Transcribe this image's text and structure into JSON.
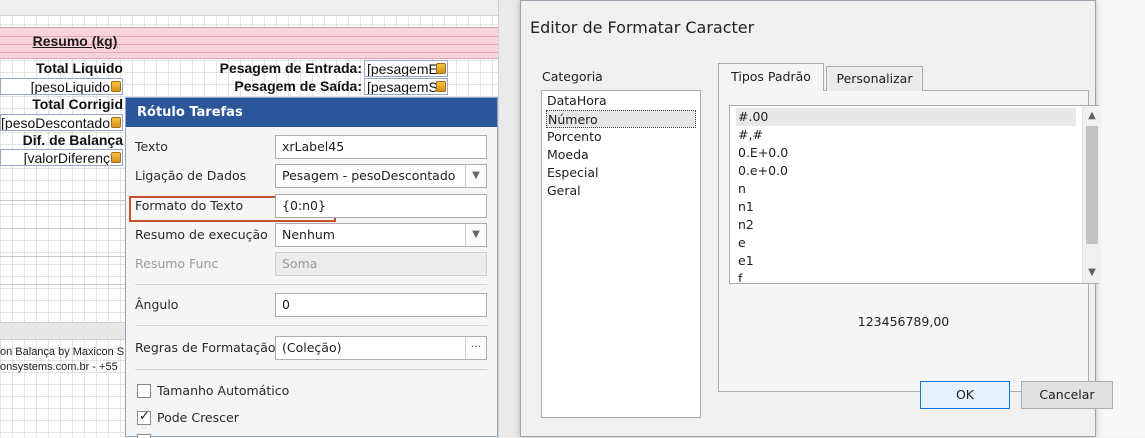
{
  "report": {
    "resumo_title": "Resumo (kg)",
    "labels": {
      "total_liquido": "Total Liquido",
      "peso_liquido": "[pesoLiquido",
      "total_corrigido": "Total Corrigid",
      "peso_descontado": "[pesoDescontado",
      "dif_balanca": "Dif. de Balança",
      "valor_diferenca": "[valorDiferenç",
      "pesagem_entrada": "Pesagem de Entrada:",
      "pesagem_entrada_field": "[pesagemE",
      "pesagem_saida": "Pesagem de Saída:",
      "pesagem_saida_field": "[pesagemS"
    },
    "footer_line1": "on Balança by Maxicon S",
    "footer_line2": "onsystems.com.br  -  +55"
  },
  "tasks_panel": {
    "title": "Rótulo Tarefas",
    "rows": {
      "texto_label": "Texto",
      "texto_value": "xrLabel45",
      "ligacao_label": "Ligação de Dados",
      "ligacao_value": "Pesagem - pesoDescontado",
      "formato_label": "Formato do Texto",
      "formato_value": "{0:n0}",
      "resumo_exec_label": "Resumo de execução",
      "resumo_exec_value": "Nenhum",
      "resumo_func_label": "Resumo Func",
      "resumo_func_value": "Soma",
      "angulo_label": "Ângulo",
      "angulo_value": "0",
      "regras_label": "Regras de Formatação",
      "regras_value": "(Coleção)",
      "regras_btn": "···"
    },
    "checkboxes": {
      "tamanho_auto": "Tamanho Automático",
      "pode_crescer": "Pode Crescer"
    }
  },
  "dialog": {
    "title": "Editor de Formatar Caracter",
    "categoria_label": "Categoria",
    "categories": [
      "DataHora",
      "Número",
      "Porcento",
      "Moeda",
      "Especial",
      "Geral"
    ],
    "selected_category": "Número",
    "tabs": {
      "padrao": "Tipos Padrão",
      "personalizar": "Personalizar"
    },
    "formats": [
      "#.00",
      "#,#",
      "0.E+0.0",
      "0.e+0.0",
      "n",
      "n1",
      "n2",
      "e",
      "e1",
      "f"
    ],
    "selected_format": "#.00",
    "preview": "123456789,00",
    "ok": "OK",
    "cancel": "Cancelar"
  }
}
